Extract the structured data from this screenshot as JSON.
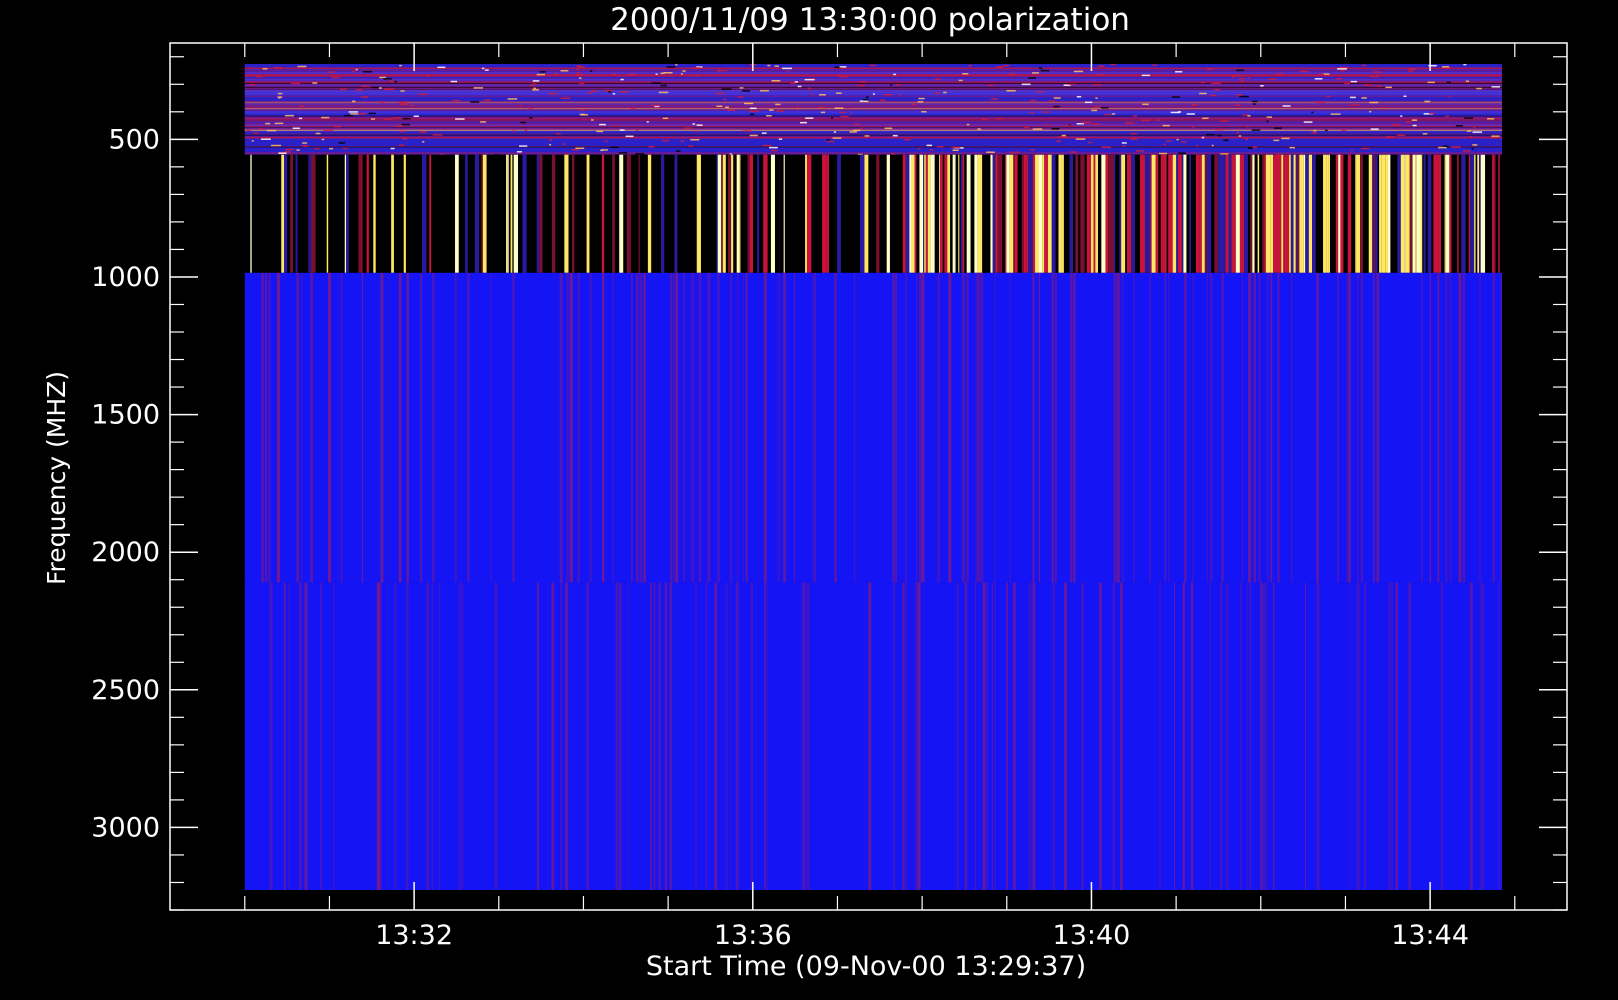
{
  "chart_data": {
    "type": "heatmap",
    "title": "2000/11/09 13:30:00 polarization",
    "xlabel": "Start Time (09-Nov-00 13:29:37)",
    "ylabel": "Frequency (MHZ)",
    "x_ticks": [
      "13:32",
      "13:36",
      "13:40",
      "13:44"
    ],
    "x_tick_values_min": [
      2.3833,
      6.3833,
      10.3833,
      14.3833
    ],
    "x_range_min": [
      -0.5,
      16.0
    ],
    "data_time_range_min": [
      0.3833,
      15.3833
    ],
    "y_ticks": [
      500,
      1000,
      1500,
      2000,
      2500,
      3000
    ],
    "y_range": [
      3300,
      150
    ],
    "y_reversed": true,
    "grid": false,
    "bands": [
      {
        "name": "low",
        "freq_range": [
          225,
          556
        ],
        "colormap": "blue-dominant noise with red/yellow horizontal channel streaks"
      },
      {
        "name": "mid",
        "freq_range": [
          556,
          985
        ],
        "colormap": "black background with vertical red/yellow/white bursts, increasing after 13:38"
      },
      {
        "name": "high1",
        "freq_range": [
          985,
          2110
        ],
        "colormap": "blue with faint red vertical striations"
      },
      {
        "name": "high2",
        "freq_range": [
          2110,
          3230
        ],
        "colormap": "blue with faint red vertical striations"
      }
    ],
    "colors": {
      "background": "#000000",
      "axis": "#ffffff",
      "blue": "#1414f5",
      "red": "#c8143c",
      "yellow": "#ffe664",
      "pale": "#ffffc8"
    }
  }
}
